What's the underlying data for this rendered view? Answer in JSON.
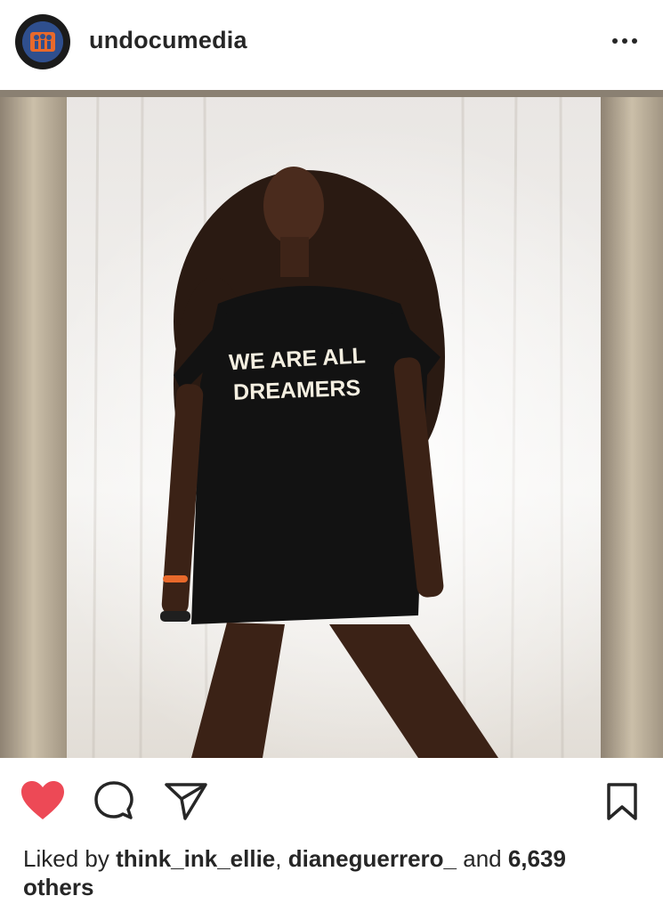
{
  "post": {
    "username": "undocumedia",
    "more_icon": "more-horizontal-icon",
    "photo": {
      "shirt_text_line1": "WE ARE ALL",
      "shirt_text_line2": "DREAMERS"
    },
    "actions": {
      "like_icon": "heart-filled-icon",
      "like_color": "#ed4956",
      "comment_icon": "comment-icon",
      "share_icon": "direct-send-icon",
      "save_icon": "bookmark-icon"
    },
    "likes": {
      "prefix": "Liked by ",
      "user1": "think_ink_ellie",
      "separator": ", ",
      "user2": "dianeguerrero_",
      "connector": " and ",
      "count": "6,639",
      "suffix": "others"
    }
  }
}
